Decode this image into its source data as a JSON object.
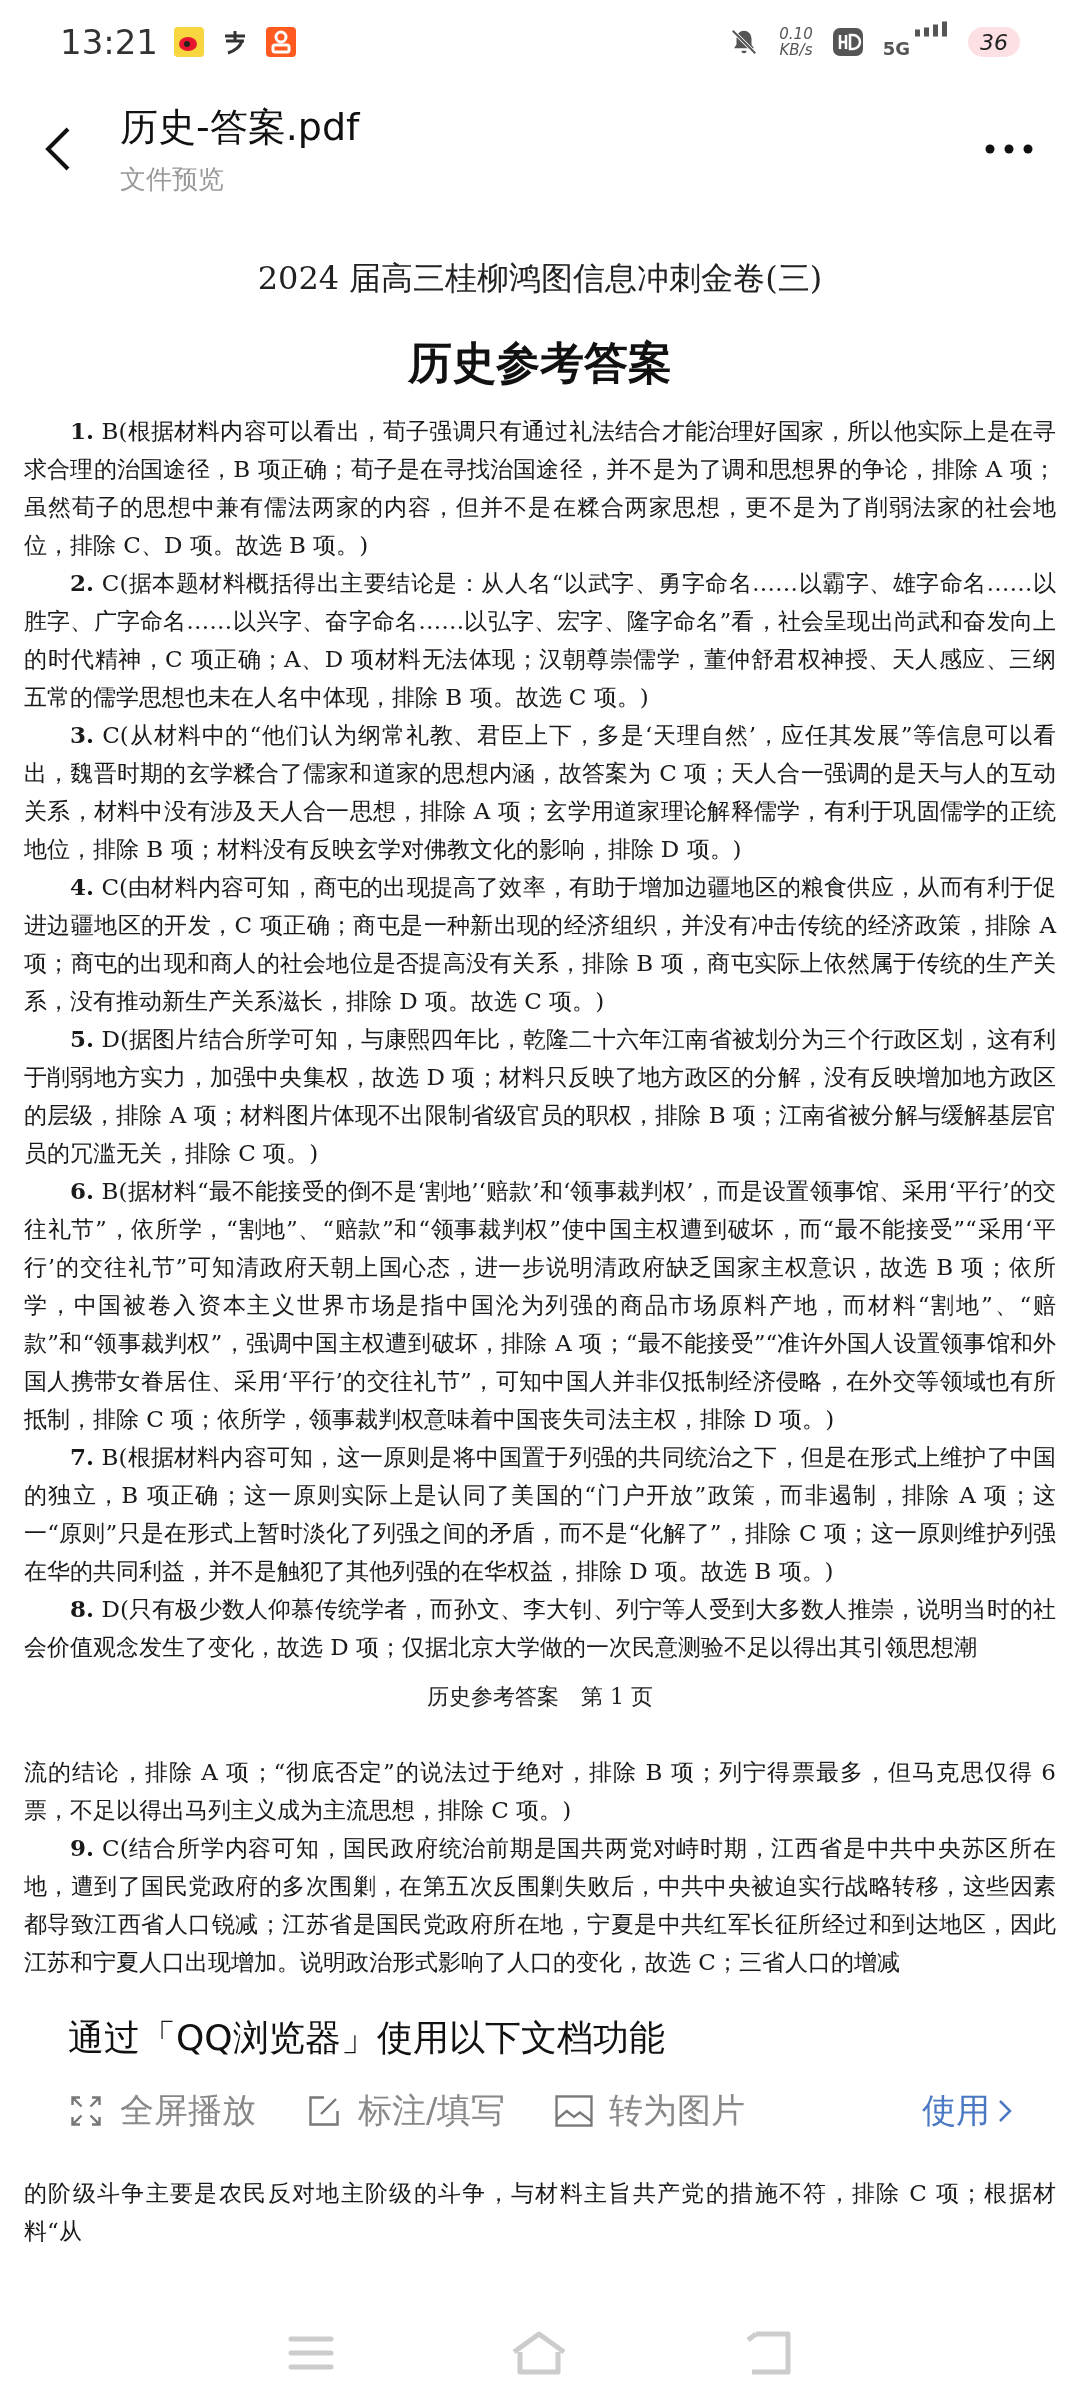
{
  "status_bar": {
    "time": "13:21",
    "network_speed": [
      "0.10",
      "KB/s"
    ],
    "network_type": "5G",
    "battery": "36"
  },
  "header": {
    "title": "历史-答案.pdf",
    "subtitle": "文件预览"
  },
  "document": {
    "pages": [
      {
        "title": "2024 届高三桂柳鸿图信息冲刺金卷(三)",
        "heading": "历史参考答案",
        "paragraphs": [
          "**1.** B(根据材料内容可以看出，荀子强调只有通过礼法结合才能治理好国家，所以他实际上是在寻求合理的治国途径，B 项正确；荀子是在寻找治国途径，并不是为了调和思想界的争论，排除 A 项；虽然荀子的思想中兼有儒法两家的内容，但并不是在糅合两家思想，更不是为了削弱法家的社会地位，排除 C、D 项。故选 B 项。)",
          "**2.** C(据本题材料概括得出主要结论是：从人名“以武字、勇字命名……以霸字、雄字命名……以胜字、广字命名……以兴字、奋字命名……以弘字、宏字、隆字命名”看，社会呈现出尚武和奋发向上的时代精神，C 项正确；A、D 项材料无法体现；汉朝尊崇儒学，董仲舒君权神授、天人感应、三纲五常的儒学思想也未在人名中体现，排除 B 项。故选 C 项。)",
          "**3.** C(从材料中的“他们认为纲常礼教、君臣上下，多是‘天理自然’，应任其发展”等信息可以看出，魏晋时期的玄学糅合了儒家和道家的思想内涵，故答案为 C 项；天人合一强调的是天与人的互动关系，材料中没有涉及天人合一思想，排除 A 项；玄学用道家理论解释儒学，有利于巩固儒学的正统地位，排除 B 项；材料没有反映玄学对佛教文化的影响，排除 D 项。)",
          "**4.** C(由材料内容可知，商屯的出现提高了效率，有助于增加边疆地区的粮食供应，从而有利于促进边疆地区的开发，C 项正确；商屯是一种新出现的经济组织，并没有冲击传统的经济政策，排除 A 项；商屯的出现和商人的社会地位是否提高没有关系，排除 B 项，商屯实际上依然属于传统的生产关系，没有推动新生产关系滋长，排除 D 项。故选 C 项。)",
          "**5.** D(据图片结合所学可知，与康熙四年比，乾隆二十六年江南省被划分为三个行政区划，这有利于削弱地方实力，加强中央集权，故选 D 项；材料只反映了地方政区的分解，没有反映增加地方政区的层级，排除 A 项；材料图片体现不出限制省级官员的职权，排除 B 项；江南省被分解与缓解基层官员的冗滥无关，排除 C 项。)",
          "**6.** B(据材料“最不能接受的倒不是‘割地’‘赔款’和‘领事裁判权’，而是设置领事馆、采用‘平行’的交往礼节”，依所学，“割地”、“赔款”和“领事裁判权”使中国主权遭到破坏，而“最不能接受”“采用‘平行’的交往礼节”可知清政府天朝上国心态，进一步说明清政府缺乏国家主权意识，故选 B 项；依所学，中国被卷入资本主义世界市场是指中国沦为列强的商品市场原料产地，而材料“割地”、“赔款”和“领事裁判权”，强调中国主权遭到破坏，排除 A 项；“最不能接受”“准许外国人设置领事馆和外国人携带女眷居住、采用‘平行’的交往礼节”，可知中国人并非仅抵制经济侵略，在外交等领域也有所抵制，排除 C 项；依所学，领事裁判权意味着中国丧失司法主权，排除 D 项。)",
          "**7.** B(根据材料内容可知，这一原则是将中国置于列强的共同统治之下，但是在形式上维护了中国的独立，B 项正确；这一原则实际上是认同了美国的“门户开放”政策，而非遏制，排除 A 项；这一“原则”只是在形式上暂时淡化了列强之间的矛盾，而不是“化解了”，排除 C 项；这一原则维护列强在华的共同利益，并不是触犯了其他列强的在华权益，排除 D 项。故选 B 项。)",
          "**8.** D(只有极少数人仰慕传统学者，而孙文、李大钊、列宁等人受到大多数人推崇，说明当时的社会价值观念发生了变化，故选 D 项；仅据北京大学做的一次民意测验不足以得出其引领思想潮"
        ],
        "footer": "历史参考答案　第 1 页"
      },
      {
        "paragraphs": [
          "流的结论，排除 A 项；“彻底否定”的说法过于绝对，排除 B 项；列宁得票最多，但马克思仅得 6 票，不足以得出马列主义成为主流思想，排除 C 项。)",
          "**9.** C(结合所学内容可知，国民政府统治前期是国共两党对峙时期，江西省是中共中央苏区所在地，遭到了国民党政府的多次围剿，在第五次反围剿失败后，中共中央被迫实行战略转移，这些因素都导致江西省人口锐减；江苏省是国民党政府所在地，宁夏是中共红军长征所经过和到达地区，因此江苏和宁夏人口出现增加。说明政治形式影响了人口的变化，故选 C；三省人口的增减"
        ],
        "after_banner": "的阶级斗争主要是农民反对地主阶级的斗争，与材料主旨共产党的措施不符，排除 C 项；根据材料“从"
      }
    ]
  },
  "banner": {
    "title": "通过「QQ浏览器」使用以下文档功能",
    "features": [
      {
        "kind": "fullscreen",
        "label": "全屏播放"
      },
      {
        "kind": "annotate",
        "label": "标注/填写"
      },
      {
        "kind": "image",
        "label": "转为图片"
      }
    ],
    "action": "使用"
  }
}
